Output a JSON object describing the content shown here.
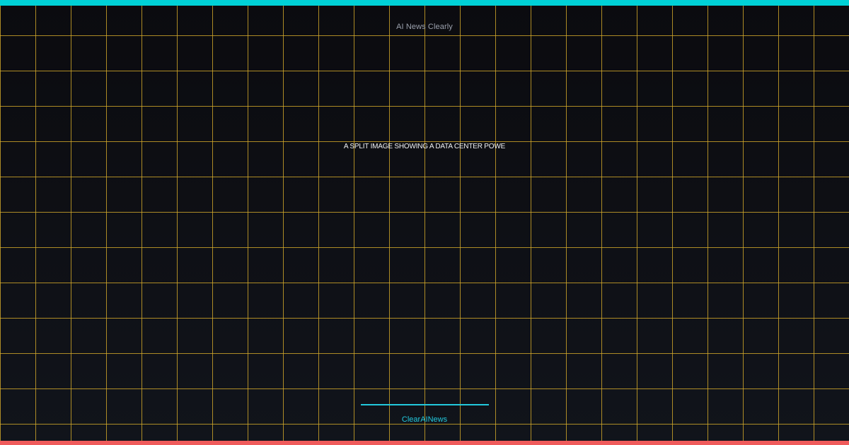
{
  "header": {
    "site_name": "AI News Clearly"
  },
  "main": {
    "headline": "A SPLIT IMAGE SHOWING A DATA CENTER POWE"
  },
  "footer": {
    "brand": "ClearAINews"
  },
  "theme": {
    "background_top": "#0b0b0f",
    "background_bottom": "#11141b",
    "grid_color": "#d4aa2b",
    "top_bar_color": "#00d1d6",
    "bottom_bar_color": "#ef5b5b",
    "accent_color": "#22c9dd"
  }
}
